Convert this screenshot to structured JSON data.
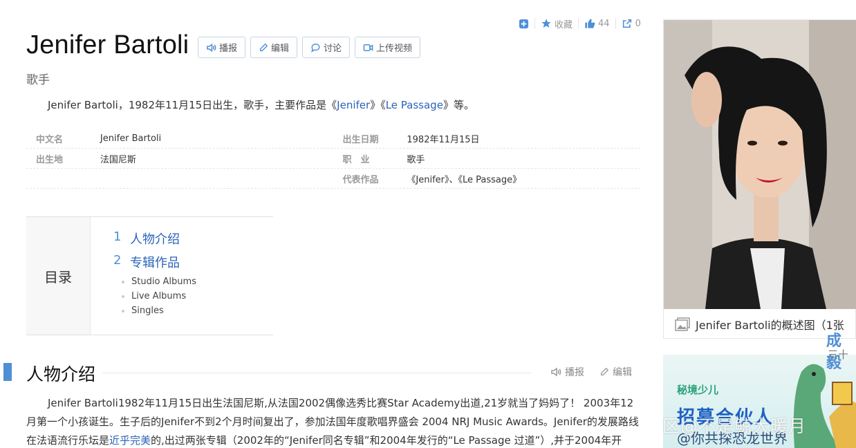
{
  "top_actions": {
    "collect_label": "收藏",
    "like_count": "44",
    "share_count": "0"
  },
  "header": {
    "title": "Jenifer Bartoli",
    "subtitle": "歌手",
    "buttons": {
      "broadcast": "播报",
      "edit": "编辑",
      "discuss": "讨论",
      "upload_video": "上传视频"
    }
  },
  "summary": {
    "prefix": "Jenifer Bartoli，1982年11月15日出生，歌手，主要作品是《",
    "work1": "Jenifer",
    "mid": "》《",
    "work2": "Le Passage",
    "suffix": "》等。"
  },
  "infobox": {
    "rows": [
      {
        "k1": "中文名",
        "v1": "Jenifer Bartoli",
        "k2": "出生日期",
        "v2": "1982年11月15日"
      },
      {
        "k1": "出生地",
        "v1": "法国尼斯",
        "k2": "职　业",
        "v2": "歌手"
      },
      {
        "k1": "",
        "v1": "",
        "k2": "代表作品",
        "v2": "《Jenifer》、《Le Passage》"
      }
    ]
  },
  "toc": {
    "label": "目录",
    "items": [
      {
        "num": "1",
        "label": "人物介绍"
      },
      {
        "num": "2",
        "label": "专辑作品"
      }
    ],
    "subitems": [
      "Studio Albums",
      "Live Albums",
      "Singles"
    ]
  },
  "section": {
    "title": "人物介绍",
    "broadcast": "播报",
    "edit": "编辑",
    "para_line1": "Jenifer Bartoli1982年11月15日出生法国尼斯,从法国2002偶像选秀比赛Star Academy出道,21岁就当了妈妈了！ 2003年12月",
    "para_line2": "第一个小孩诞生。生子后的Jenifer不到2个月时间复出了，参加法国年度歌唱界盛会 2004 NRJ Music Awards。Jenifer的发展路",
    "para_line3_a": "线在法语流行乐坛是",
    "para_line3_link": "近乎完美",
    "para_line3_b": "的,出过两张专辑（2002年的“Jenifer同名专辑”和2004年发行的“Le Passage 过道”）,并于2004年开"
  },
  "sidebar": {
    "photo_caption": "Jenifer Bartoli的概述图（1张",
    "ad_logo": "秘境少儿",
    "ad_title": "招募合伙人",
    "ad_sub": "@你共探恐龙世界",
    "edge1": "成毅",
    "edge2": "三十",
    "overlay": "区@不是鲸大暖月"
  }
}
